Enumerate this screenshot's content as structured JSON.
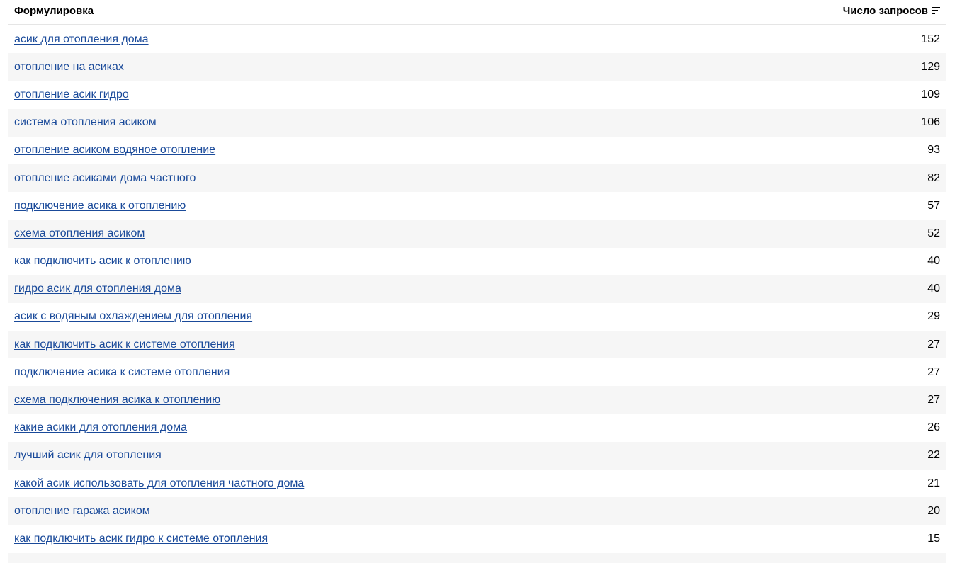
{
  "header": {
    "phrase_label": "Формулировка",
    "count_label": "Число запросов"
  },
  "icons": {
    "sort": "sort-icon"
  },
  "colors": {
    "link": "#1a4a9a",
    "stripe": "#f6f6f6"
  },
  "rows": [
    {
      "phrase": "асик для отопления дома",
      "count": "152"
    },
    {
      "phrase": "отопление на асиках",
      "count": "129"
    },
    {
      "phrase": "отопление асик гидро",
      "count": "109"
    },
    {
      "phrase": "система отопления асиком",
      "count": "106"
    },
    {
      "phrase": "отопление асиком водяное отопление",
      "count": "93"
    },
    {
      "phrase": "отопление асиками дома частного",
      "count": "82"
    },
    {
      "phrase": "подключение асика к отоплению",
      "count": "57"
    },
    {
      "phrase": "схема отопления асиком",
      "count": "52"
    },
    {
      "phrase": "как подключить асик к отоплению",
      "count": "40"
    },
    {
      "phrase": "гидро асик для отопления дома",
      "count": "40"
    },
    {
      "phrase": "асик с водяным охлаждением для отопления",
      "count": "29"
    },
    {
      "phrase": "как подключить асик к системе отопления",
      "count": "27"
    },
    {
      "phrase": "подключение асика к системе отопления",
      "count": "27"
    },
    {
      "phrase": "схема подключения асика к отоплению",
      "count": "27"
    },
    {
      "phrase": "какие асики для отопления дома",
      "count": "26"
    },
    {
      "phrase": "лучший асик для отопления",
      "count": "22"
    },
    {
      "phrase": "какой асик использовать для отопления частного дома",
      "count": "21"
    },
    {
      "phrase": "отопление гаража асиком",
      "count": "20"
    },
    {
      "phrase": "как подключить асик гидро к системе отопления",
      "count": "15"
    }
  ]
}
